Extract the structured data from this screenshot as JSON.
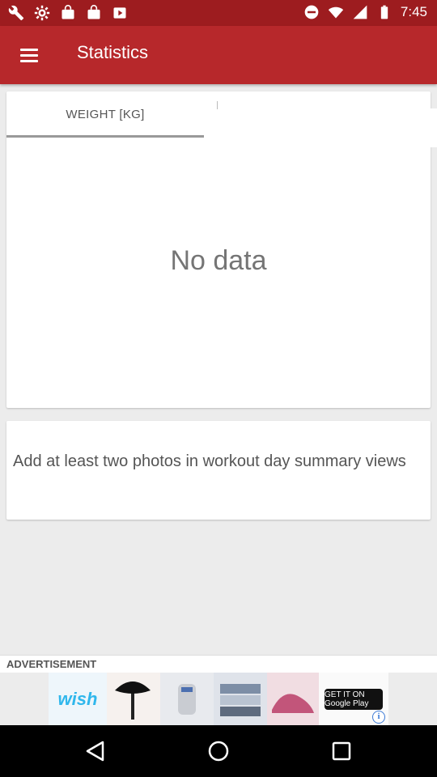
{
  "status_bar": {
    "time": "7:45",
    "icons": [
      "wrench-icon",
      "settings-icon",
      "bag-icon",
      "bag-icon",
      "play-store-icon",
      "minus-circle-icon",
      "wifi-icon",
      "signal-icon",
      "battery-icon"
    ]
  },
  "app_bar": {
    "title": "Statistics",
    "menu_icon": "hamburger-menu-icon"
  },
  "chart_card": {
    "tab_label": "WEIGHT [KG]",
    "empty_message": "No data"
  },
  "info_card": {
    "message": "Add at least two photos in workout day summary views"
  },
  "advertisement": {
    "label": "ADVERTISEMENT",
    "brand": "wish",
    "store_badge": "GET IT ON Google Play",
    "info_icon": "info-icon"
  },
  "nav_bar": {
    "icons": [
      "back-icon",
      "home-icon",
      "recents-icon"
    ]
  },
  "colors": {
    "status_bar": "#9d1c1f",
    "app_bar": "#b7282b",
    "background": "#ececec"
  }
}
